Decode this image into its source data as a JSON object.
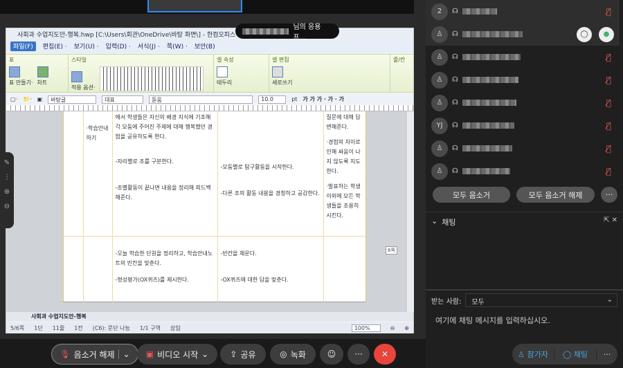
{
  "hwp": {
    "title": "사회과 수업지도안-행복.hwp [C:\\Users\\회관\\OneDrive\\바탕 화면\\] - 한컴오피스",
    "menu": [
      "파일(F)",
      "편집(E) ·",
      "보기(U) ·",
      "입력(D) ·",
      "서식(J) ·",
      "쪽(W) ·",
      "보안(B)"
    ],
    "ribbon": {
      "groups": [
        {
          "label": "표",
          "items": [
            "표 만들기·",
            "차트"
          ]
        },
        {
          "label": "스타일",
          "items": [
            "적용 옵션·"
          ]
        },
        {
          "label": "셀 속성",
          "items": [
            "테두리"
          ]
        },
        {
          "label": "셀 편집",
          "items": [
            "세로쓰기"
          ]
        },
        {
          "label": "줄/칸",
          "items": []
        }
      ]
    },
    "format_bar": {
      "style": "바탕글",
      "para": "대표",
      "font": "돋움",
      "size": "10.0",
      "unit": "pt",
      "char_buttons": "가 가 가 · 가 · 가"
    },
    "table": {
      "row1": {
        "label": "·학습안내하기",
        "col2": [
          "에서 학생들은 자신의 배경 지식에 기초해 각 모둠에 주어진 주제에 대해 행복했던 경험을 공유하도록 한다.",
          "-자리별로 조를 구분한다.",
          "-조별활동이 끝나면 내용을 정리해 피드백 해준다."
        ],
        "col3": [
          "-모둠별로 탐구활동을 시작한다.",
          "-다른 조의 활동 내용을 경청하고 공감한다."
        ],
        "col4": [
          "질문에 대해 답변해준다.",
          "·경험의 차이로 인해 싸움이 나지 않도록 지도한다.",
          "·발표하는 학생 이외에 모든 학생들을 조용히 시킨다."
        ]
      },
      "row2": {
        "col2": [
          "-오늘 학습한 단원을 정리하고, 학습안내노트의 빈칸을 맞춘다.",
          "-형성평가(OX퀴즈)를 제시한다."
        ],
        "col3": [
          "-빈칸을 채운다.",
          "-OX퀴즈에 대한 답을 맞춘다."
        ]
      }
    },
    "side_tab": "6쪽",
    "sheet_tab": "사회과 수업지도안-행복",
    "status": [
      "5/6쪽",
      "1단",
      "11줄",
      "1칸",
      "(C6): 문단 나눔",
      "1/1 구역",
      "삽입"
    ],
    "zoom": "100%"
  },
  "share_popup": {
    "suffix": "님의 응용프..."
  },
  "participants": [
    {
      "avatar": "2",
      "muted": true
    },
    {
      "avatar": "",
      "muted": false,
      "host": true
    },
    {
      "avatar": "",
      "muted": true
    },
    {
      "avatar": "",
      "muted": true
    },
    {
      "avatar": "",
      "muted": true
    },
    {
      "avatar": "YJ",
      "muted": true
    },
    {
      "avatar": "",
      "muted": true
    },
    {
      "avatar": "",
      "muted": true
    }
  ],
  "panel": {
    "mute_all": "모두 음소거",
    "unmute_all": "모두 음소거 해제",
    "more": "···",
    "chat_title": "채팅",
    "recipient_label": "받는 사람:",
    "recipient_value": "모두",
    "chat_placeholder": "여기에 채팅 메시지를 입력하십시오.",
    "participants_btn": "참가자",
    "chat_btn": "채팅"
  },
  "bottom": {
    "unmute": "음소거 해제",
    "video": "비디오 시작",
    "share": "공유",
    "record": "녹화",
    "more": "···"
  },
  "colors": {
    "leave": "#e8453c",
    "accent": "#4aa3df",
    "muted": "#e55555",
    "unmuted": "#3cb371"
  }
}
